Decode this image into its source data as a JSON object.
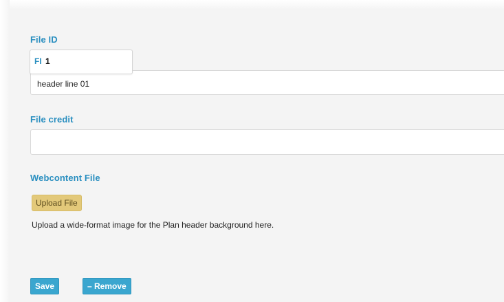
{
  "file_id": {
    "label": "File ID",
    "prefix": "FI",
    "value": "1",
    "header_line": "header line 01"
  },
  "file_credit": {
    "label": "File credit",
    "value": ""
  },
  "webcontent": {
    "label": "Webcontent File",
    "upload_label": "Upload File",
    "help_text": "Upload a wide-format image for the Plan header background here."
  },
  "actions": {
    "save_label": "Save",
    "remove_label": "– Remove"
  },
  "colors": {
    "label_accent": "#2a8fc0",
    "button_blue": "#3aa6cf",
    "upload_yellow": "#e3c97a"
  }
}
